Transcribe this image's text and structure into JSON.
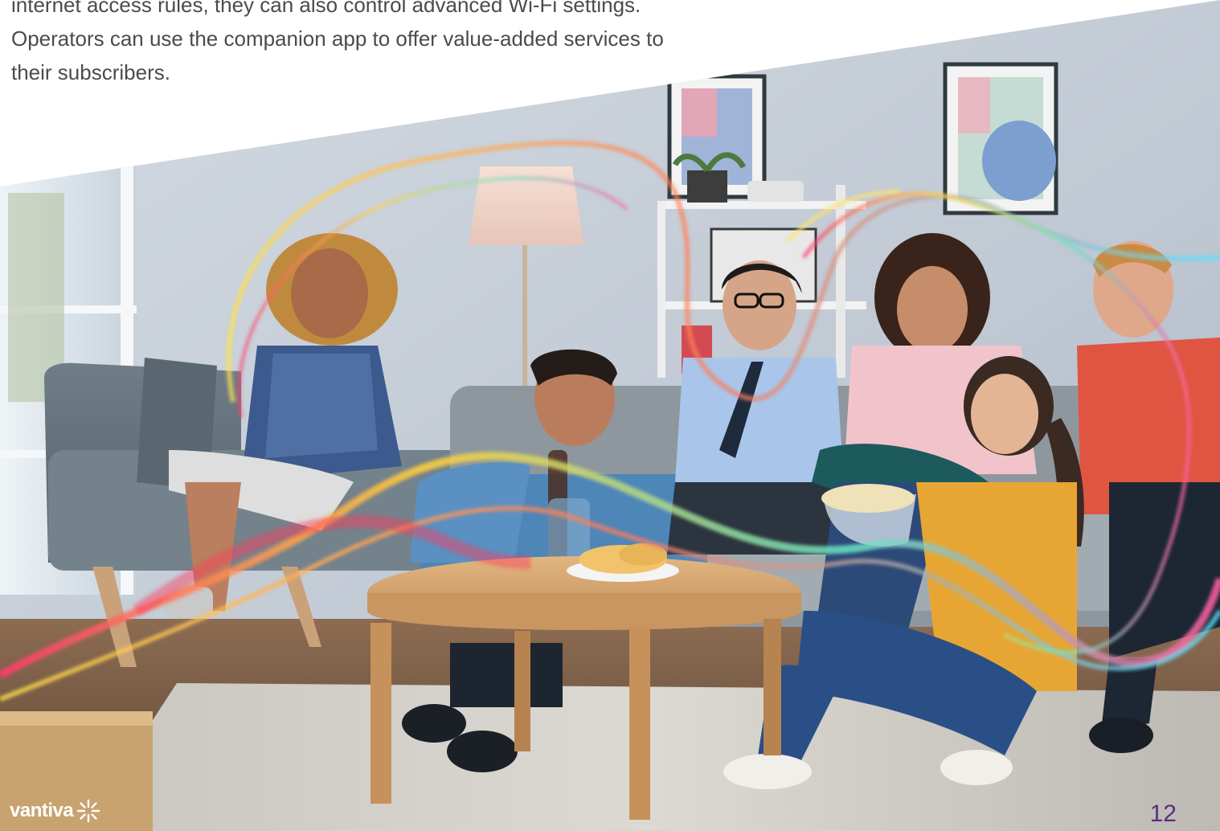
{
  "body_text": {
    "lines": [
      "internet access rules, they can also control advanced Wi-Fi settings.",
      "Operators can use the companion app to offer value-added services to",
      "their subscribers."
    ]
  },
  "photo": {
    "subject": "group-of-friends-laughing-in-living-room",
    "overlay": "wifi-wave-ribbons"
  },
  "footer": {
    "logo_text": "vantiva",
    "logo_icon": "starburst-icon",
    "page_number": "12"
  },
  "colors": {
    "text": "#4b4b4b",
    "brand_purple": "#5a2d82",
    "white": "#ffffff"
  }
}
